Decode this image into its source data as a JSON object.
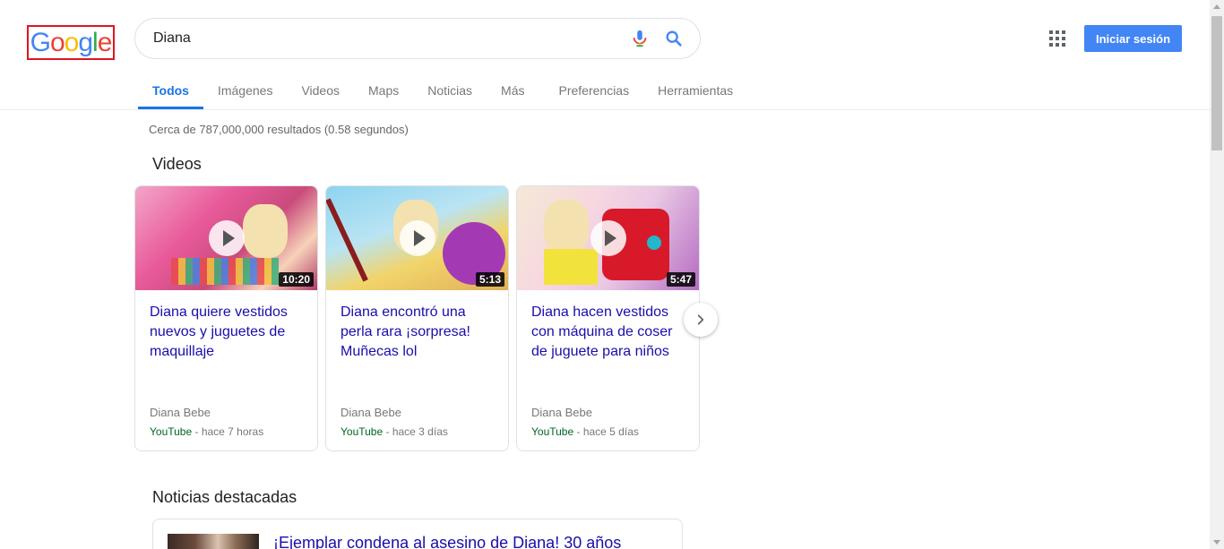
{
  "header": {
    "search_value": "Diana",
    "signin_label": "Iniciar sesión"
  },
  "tabs": [
    {
      "label": "Todos",
      "active": true
    },
    {
      "label": "Imágenes"
    },
    {
      "label": "Videos"
    },
    {
      "label": "Maps"
    },
    {
      "label": "Noticias"
    },
    {
      "label": "Más"
    },
    {
      "label": "Preferencias"
    },
    {
      "label": "Herramientas"
    }
  ],
  "results": {
    "stats": "Cerca de 787,000,000 resultados (0.58 segundos)"
  },
  "videos": {
    "section_title": "Videos",
    "items": [
      {
        "title": "Diana quiere vestidos nuevos y juguetes de maquillaje",
        "duration": "10:20",
        "channel": "Diana Bebe",
        "source": "YouTube",
        "age": " - hace 7 horas"
      },
      {
        "title": "Diana encontró una perla rara ¡sorpresa! Muñecas lol",
        "duration": "5:13",
        "channel": "Diana Bebe",
        "source": "YouTube",
        "age": " - hace 3 días"
      },
      {
        "title": "Diana hacen vestidos con máquina de coser de juguete para niños",
        "duration": "5:47",
        "channel": "Diana Bebe",
        "source": "YouTube",
        "age": " - hace 5 días"
      }
    ]
  },
  "news": {
    "section_title": "Noticias destacadas",
    "items": [
      {
        "title": "¡Ejemplar condena al asesino de Diana! 30 años"
      }
    ]
  },
  "colors": {
    "accent": "#1a73e8",
    "link": "#1a0dab",
    "source_green": "#006621",
    "button_blue": "#4285f4",
    "logo_border": "#e0141e"
  }
}
